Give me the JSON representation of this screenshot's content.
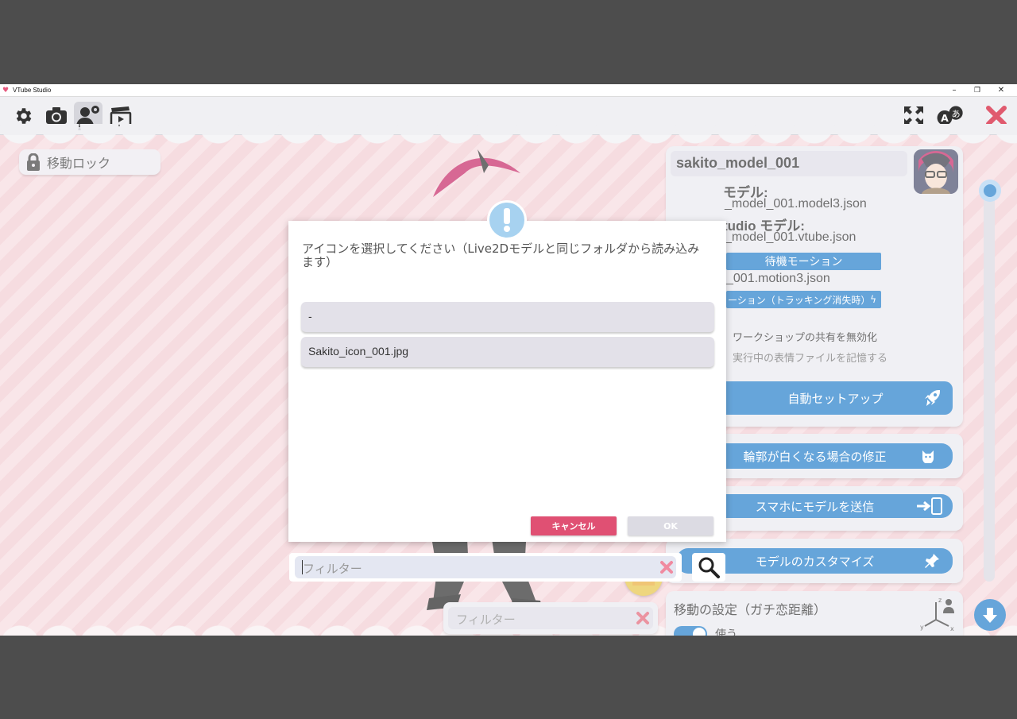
{
  "window": {
    "title": "VTube Studio",
    "minimize_glyph": "–",
    "restore_glyph": "❐",
    "close_glyph": "✕"
  },
  "toolbar": {
    "icons": [
      "gear-icon",
      "camera-icon",
      "model-settings-icon",
      "clapperboard-icon",
      "fullscreen-icon",
      "language-icon",
      "close-icon"
    ]
  },
  "lock": {
    "label": "移動ロック"
  },
  "model_panel": {
    "name": "sakito_model_001",
    "live2d_label": "モデル:",
    "live2d_file": "_model_001.model3.json",
    "vts_label": "tudio モデル:",
    "vts_file": "_model_001.vtube.json",
    "idle_motion_button": "待機モーション",
    "idle_motion_file": "_001.motion3.json",
    "tracking_lost_button": "ーション（トラッキング消失時）",
    "workshop_label": "ワークショップの共有を無効化",
    "remember_expression_label": "実行中の表情ファイルを記憶する",
    "auto_setup_button": "自動セットアップ",
    "fix_outline_button": "輪郭が白くなる場合の修正",
    "send_phone_button": "スマホにモデルを送信",
    "customize_button": "モデルのカスタマイズ",
    "movement_title": "移動の設定（ガチ恋距離）",
    "movement_toggle_label": "使う"
  },
  "bottom_filter": {
    "placeholder": "フィルター"
  },
  "dialog": {
    "message": "アイコンを選択してください（Live2Dモデルと同じフォルダから読み込みます）",
    "items": [
      "-",
      "Sakito_icon_001.jpg"
    ],
    "cancel_label": "キャンセル",
    "ok_label": "OK",
    "filter_placeholder": "フィルター"
  },
  "colors": {
    "accent_blue": "#1475c7",
    "cancel_red": "#e05073",
    "workspace_pink": "#f2c9d0"
  }
}
